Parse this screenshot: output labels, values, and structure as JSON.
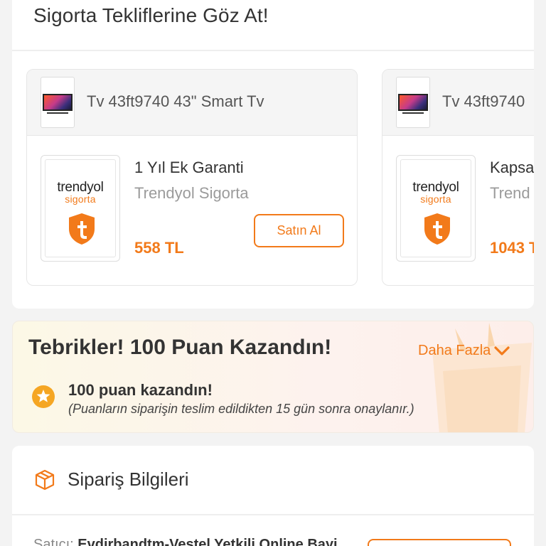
{
  "colors": {
    "accent": "#f27a1a",
    "text": "#333333",
    "muted": "#9b9b9b"
  },
  "insurance": {
    "title": "Sigorta Tekliflerine Göz At!",
    "offers": [
      {
        "product": "Tv 43ft9740 43\" Smart Tv",
        "logo_word": "trendyol",
        "logo_sub": "sigorta",
        "plan": "1 Yıl Ek Garanti",
        "provider": "Trendyol Sigorta",
        "price": "558 TL",
        "buy_label": "Satın Al"
      },
      {
        "product": "Tv 43ft9740",
        "logo_word": "trendyol",
        "logo_sub": "sigorta",
        "plan": "Kapsa",
        "provider": "Trend",
        "price": "1043 T"
      }
    ]
  },
  "points": {
    "title": "Tebrikler! 100 Puan Kazandın!",
    "more_label": "Daha Fazla",
    "main": "100 puan kazandın!",
    "note": "(Puanların siparişin teslim edildikten 15 gün sonra onaylanır.)"
  },
  "order": {
    "title": "Sipariş Bilgileri",
    "seller_label": "Satıcı:",
    "seller_name": "Evdirbandtm-Vestel Yetkili Online Bayi"
  }
}
